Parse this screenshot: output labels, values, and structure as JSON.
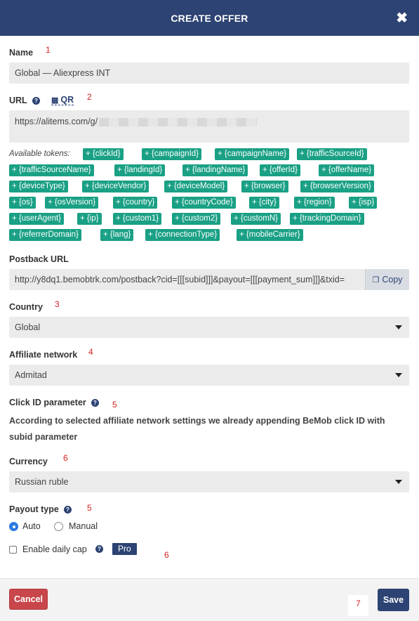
{
  "header": {
    "title": "CREATE OFFER",
    "close_icon": "close-icon",
    "close_glyph": "✖"
  },
  "annotations": [
    "1",
    "2",
    "3",
    "4",
    "5",
    "6",
    "5",
    "6",
    "7"
  ],
  "name": {
    "label": "Name",
    "value": "Global —  Aliexpress INT"
  },
  "url": {
    "label": "URL",
    "qr_label": "QR",
    "value": "https://alitems.com/g/"
  },
  "tokens": {
    "label": "Available tokens:",
    "items": [
      "+ {clickId}",
      "+ {campaignId}",
      "+ {campaignName}",
      "+ {trafficSourceId}",
      "+ {trafficSourceName}",
      "+ {landingId}",
      "+ {landingName}",
      "+ {offerId}",
      "+ {offerName}",
      "+ {deviceType}",
      "+ {deviceVendor}",
      "+ {deviceModel}",
      "+ {browser}",
      "+ {browserVersion}",
      "+ {os}",
      "+ {osVersion}",
      "+ {country}",
      "+ {countryCode}",
      "+ {city}",
      "+ {region}",
      "+ {isp}",
      "+ {userAgent}",
      "+ {ip}",
      "+ {custom1}",
      "+ {custom2}",
      "+ {customN}",
      "+ {trackingDomain}",
      "+ {referrerDomain}",
      "+ {lang}",
      "+ {connectionType}",
      "+ {mobileCarrier}"
    ]
  },
  "postback": {
    "label": "Postback URL",
    "value": "http://y8dq1.bemobtrk.com/postback?cid=[[[subid]]]&payout=[[[payment_sum]]]&txid=",
    "copy_label": "Copy"
  },
  "country": {
    "label": "Country",
    "value": "Global"
  },
  "affiliate": {
    "label": "Affiliate network",
    "value": "Admitad"
  },
  "click_id": {
    "label": "Click ID parameter",
    "description": "According to selected affiliate network settings we already appending BeMob click ID with subid parameter"
  },
  "currency": {
    "label": "Currency",
    "value": "Russian ruble"
  },
  "payout": {
    "label": "Payout type",
    "auto": "Auto",
    "manual": "Manual",
    "selected": "Auto"
  },
  "daily_cap": {
    "label": "Enable daily cap",
    "badge": "Pro",
    "checked": false
  },
  "footer": {
    "cancel": "Cancel",
    "save": "Save"
  },
  "colors": {
    "header": "#2d4373",
    "token": "#1aa085",
    "cancel": "#c9464b",
    "save": "#2d4373"
  }
}
